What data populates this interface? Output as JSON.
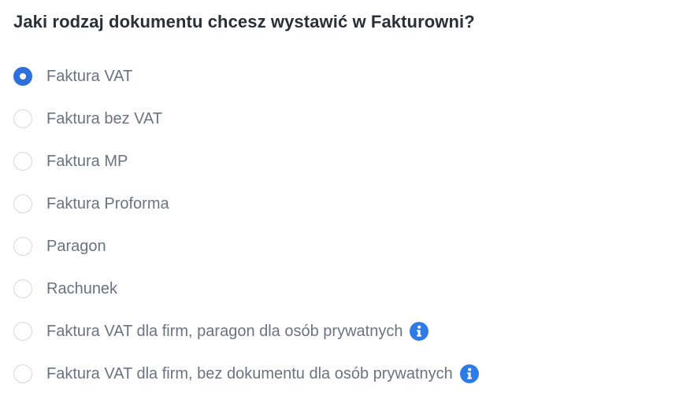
{
  "question": "Jaki rodzaj dokumentu chcesz wystawić w Fakturowni?",
  "colors": {
    "accent": "#2f6fdb",
    "info": "#2f7be5",
    "label": "#6b7280",
    "heading": "#2b2f36"
  },
  "options": [
    {
      "label": "Faktura VAT",
      "selected": true,
      "info_icon": false
    },
    {
      "label": "Faktura bez VAT",
      "selected": false,
      "info_icon": false
    },
    {
      "label": "Faktura MP",
      "selected": false,
      "info_icon": false
    },
    {
      "label": "Faktura Proforma",
      "selected": false,
      "info_icon": false
    },
    {
      "label": "Paragon",
      "selected": false,
      "info_icon": false
    },
    {
      "label": "Rachunek",
      "selected": false,
      "info_icon": false
    },
    {
      "label": "Faktura VAT dla firm, paragon dla osób prywatnych",
      "selected": false,
      "info_icon": "info-icon"
    },
    {
      "label": "Faktura VAT dla firm, bez dokumentu dla osób prywatnych",
      "selected": false,
      "info_icon": "info-icon"
    }
  ]
}
